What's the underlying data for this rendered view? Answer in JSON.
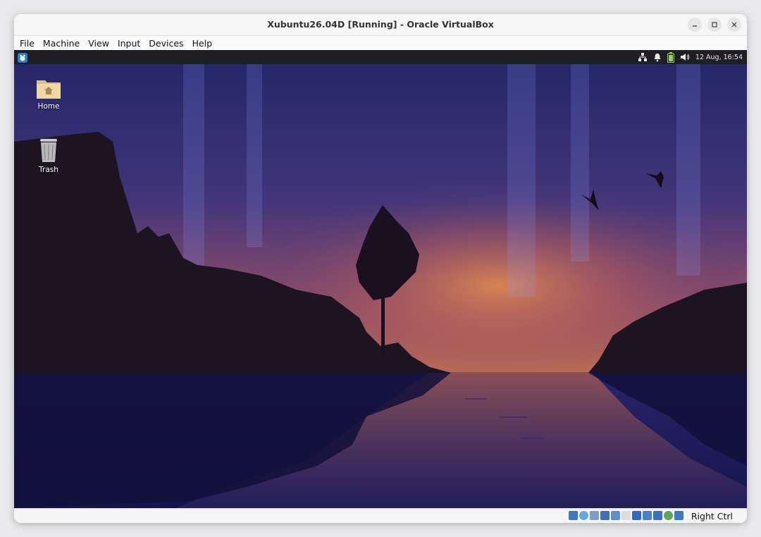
{
  "window": {
    "title": "Xubuntu26.04D [Running] - Oracle VirtualBox",
    "controls": [
      "minimize",
      "maximize",
      "close"
    ]
  },
  "menubar": {
    "items": [
      {
        "label": "File"
      },
      {
        "label": "Machine"
      },
      {
        "label": "View"
      },
      {
        "label": "Input"
      },
      {
        "label": "Devices"
      },
      {
        "label": "Help"
      }
    ]
  },
  "guest": {
    "panel": {
      "clock": "12 Aug, 16:54",
      "tray_icons": [
        "network-icon",
        "notification-bell-icon",
        "battery-icon",
        "volume-icon"
      ]
    },
    "desktop": {
      "icons": [
        {
          "label": "Home",
          "icon": "home-folder-icon"
        },
        {
          "label": "Trash",
          "icon": "trash-icon"
        }
      ]
    }
  },
  "statusbar": {
    "host_key": "Right Ctrl",
    "device_icons": [
      "hard-disk-icon",
      "optical-drive-icon",
      "audio-icon",
      "network-adapter-icon",
      "usb-icon",
      "shared-folders-icon",
      "display-icon",
      "video-capture-icon",
      "vm-state-icon",
      "cpu-icon",
      "mouse-integration-icon",
      "keyboard-capture-icon"
    ]
  },
  "colors": {
    "sky_top": "#2a2b6e",
    "sky_glow": "#d9824a",
    "water": "#1b1a5c",
    "silhouette": "#1a1220"
  }
}
